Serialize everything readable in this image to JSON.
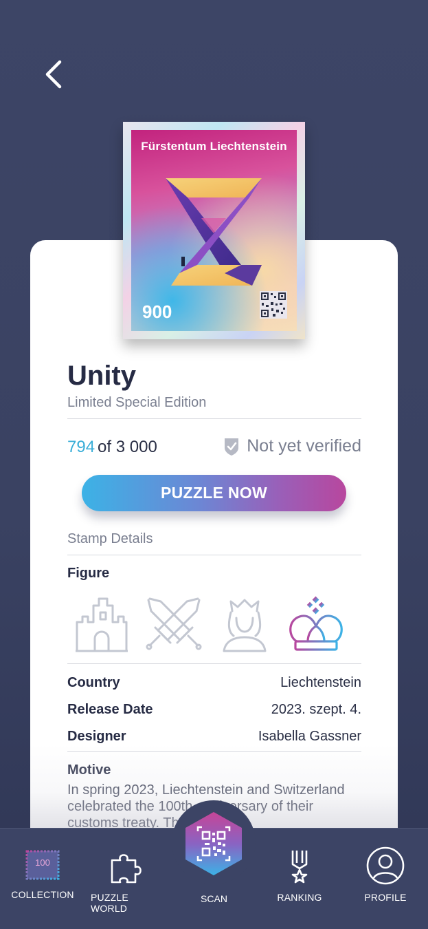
{
  "header": {
    "back_icon": "chevron-left-icon"
  },
  "stamp": {
    "country_text": "Fürstentum Liechtenstein",
    "value": "900",
    "art_icon": "impossible-hourglass-art",
    "qr_icon": "qr-code-icon"
  },
  "item": {
    "title": "Unity",
    "subtitle": "Limited Special Edition",
    "owned_number": "794",
    "of_label": "of",
    "total": "3 000",
    "verify_icon": "shield-check-icon",
    "verify_status": "Not yet verified"
  },
  "actions": {
    "puzzle_label": "PUZZLE NOW"
  },
  "details": {
    "section_label": "Stamp Details",
    "figure_label": "Figure",
    "figure_icons": [
      "castle-icon",
      "crossed-swords-icon",
      "princess-icon",
      "crown-icon"
    ],
    "figure_selected": "crown-icon",
    "rows": [
      {
        "key": "Country",
        "value": "Liechtenstein"
      },
      {
        "key": "Release Date",
        "value": "2023. szept. 4."
      },
      {
        "key": "Designer",
        "value": "Isabella Gassner"
      }
    ],
    "motive_label": "Motive",
    "motive_text": "In spring 2023, Liechtenstein and Switzerland celebrated the 100th anniversary of their customs treaty. The"
  },
  "nav": {
    "items": [
      {
        "label": "COLLECTION",
        "icon": "stamp-collection-icon",
        "badge": "100"
      },
      {
        "label": "PUZZLE WORLD",
        "icon": "puzzle-piece-icon"
      },
      {
        "label": "SCAN",
        "icon": "qr-scan-icon"
      },
      {
        "label": "RANKING",
        "icon": "medal-icon"
      },
      {
        "label": "PROFILE",
        "icon": "user-icon"
      }
    ]
  },
  "colors": {
    "background": "#3d4566",
    "accent_blue": "#3aaed8",
    "accent_magenta": "#b8479e",
    "card": "#ffffff"
  }
}
